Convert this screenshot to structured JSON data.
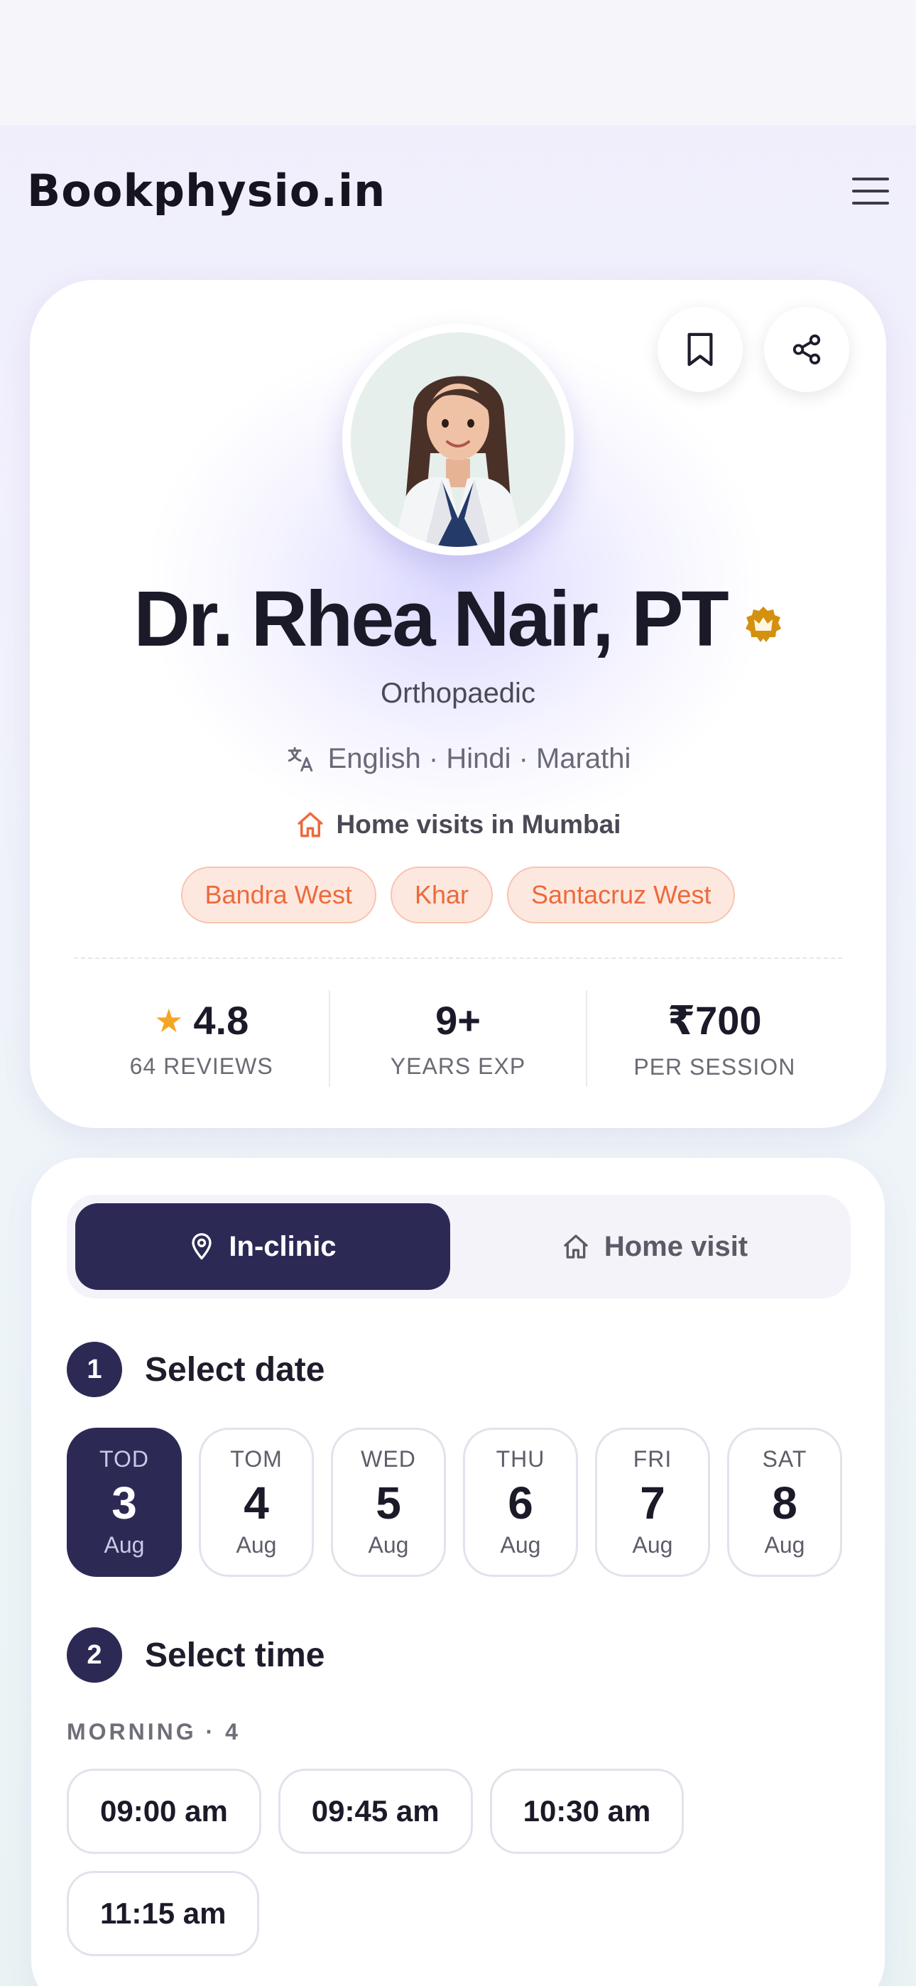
{
  "app": {
    "logo": "Bookphysio.in"
  },
  "profile": {
    "name": "Dr. Rhea Nair, PT",
    "specialty": "Orthopaedic",
    "languages": "English · Hindi · Marathi",
    "home_visits": "Home visits in Mumbai",
    "areas": [
      "Bandra West",
      "Khar",
      "Santacruz West"
    ],
    "stats": [
      {
        "value": "4.8",
        "label": "64 REVIEWS",
        "icon": "star-icon"
      },
      {
        "value": "9+",
        "label": "YEARS EXP"
      },
      {
        "value": "₹700",
        "label": "PER SESSION"
      }
    ]
  },
  "booking": {
    "modes": [
      {
        "label": "In-clinic",
        "icon": "location-pin-icon",
        "selected": true
      },
      {
        "label": "Home visit",
        "icon": "home-icon",
        "selected": false
      }
    ],
    "step1": {
      "num": "1",
      "title": "Select date"
    },
    "dates": [
      {
        "dow": "TOD",
        "day": "3",
        "month": "Aug",
        "selected": true
      },
      {
        "dow": "TOM",
        "day": "4",
        "month": "Aug"
      },
      {
        "dow": "WED",
        "day": "5",
        "month": "Aug"
      },
      {
        "dow": "THU",
        "day": "6",
        "month": "Aug"
      },
      {
        "dow": "FRI",
        "day": "7",
        "month": "Aug"
      },
      {
        "dow": "SAT",
        "day": "8",
        "month": "Aug"
      }
    ],
    "step2": {
      "num": "2",
      "title": "Select time"
    },
    "period_label": "MORNING · 4",
    "slots": [
      "09:00 am",
      "09:45 am",
      "10:30 am",
      "11:15 am"
    ]
  },
  "colors": {
    "primary": "#2c2a55",
    "accent": "#ec6a3c",
    "star": "#f5a524",
    "badge": "#d4900f"
  }
}
